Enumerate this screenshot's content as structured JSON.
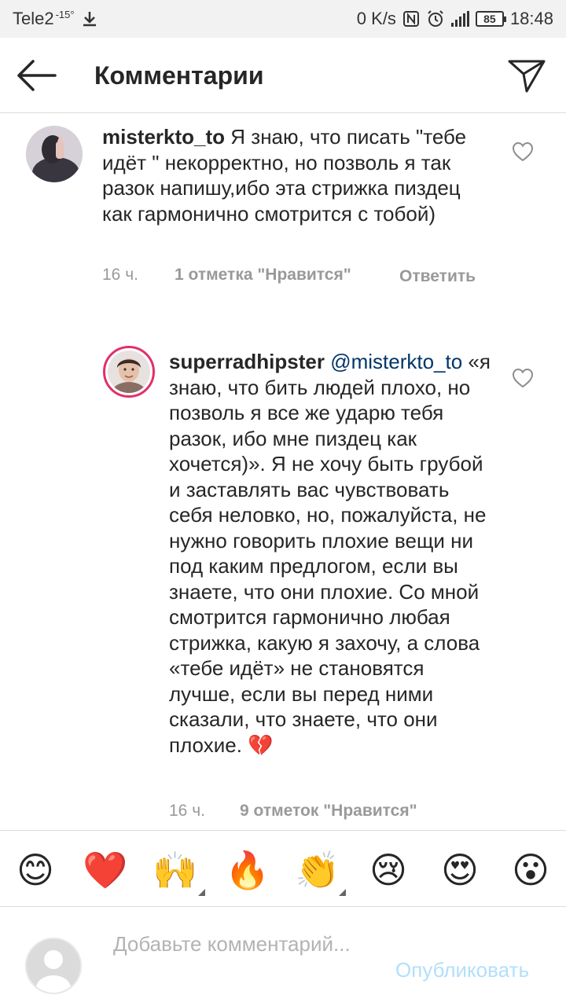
{
  "status_bar": {
    "carrier": "Tele2",
    "temperature": "-15°",
    "net_speed": "0 K/s",
    "battery": "85",
    "time": "18:48"
  },
  "header": {
    "title": "Комментарии"
  },
  "comments": [
    {
      "username": "misterkto_to",
      "text": "Я знаю, что писать \"тебе идёт \" некорректно, но позволь я так разок напишу,ибо эта стрижка пиздец как гармонично смотрится с тобой)",
      "time": "16 ч.",
      "likes": "1 отметка \"Нравится\"",
      "reply": "Ответить"
    },
    {
      "username": "superradhipster",
      "mention": "@misterkto_to",
      "text": "«я знаю, что бить людей плохо, но позволь я все же ударю тебя разок, ибо мне пиздец как хочется)». Я не хочу быть грубой и заставлять вас чувствовать себя неловко, но, пожалуйста, не нужно говорить плохие вещи ни под каким предлогом, если вы знаете, что они плохие. Со мной смотрится гармонично любая стрижка, какую я захочу, а слова «тебе идёт» не становятся лучше, если вы перед ними сказали, что знаете, что они плохие. 💔",
      "time": "16 ч.",
      "likes": "9 отметок \"Нравится\""
    }
  ],
  "emoji_bar": [
    "😊",
    "❤️",
    "🙌",
    "🔥",
    "👏",
    "😢",
    "😍",
    "😮"
  ],
  "input": {
    "placeholder": "Добавьте комментарий...",
    "publish_label": "Опубликовать"
  },
  "colors": {
    "text": "#262626",
    "meta": "#999999",
    "mention": "#003569",
    "publish_disabled": "#b2dffc",
    "divider": "#dbdbdb"
  }
}
